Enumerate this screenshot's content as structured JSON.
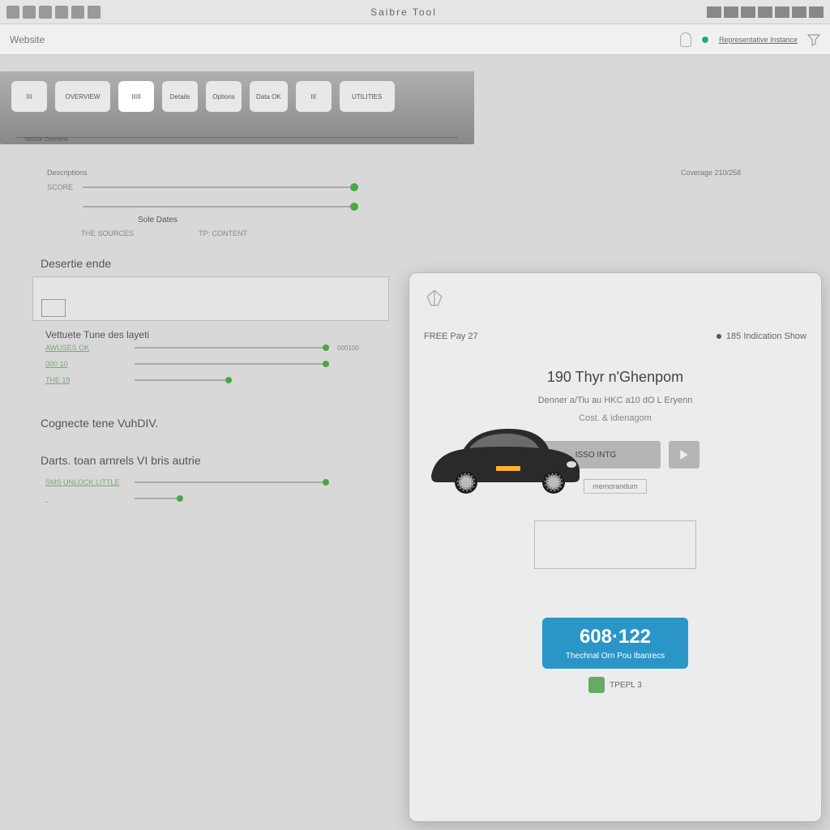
{
  "window": {
    "title": "Saibre Tool"
  },
  "toolbar": {
    "label": "Website",
    "status_text": "Representative Instance"
  },
  "tabs": {
    "items": [
      {
        "label": "III"
      },
      {
        "label": "OVERVIEW"
      },
      {
        "label": "IIIII"
      },
      {
        "label": "Details"
      },
      {
        "label": "Options"
      },
      {
        "label": "Data\nOK"
      },
      {
        "label": "III"
      },
      {
        "label": "UTILITIES"
      }
    ],
    "footer": "Vehicle Overview"
  },
  "sliders": {
    "header_left": "Descriptions",
    "header_right": "Coverage 210/258",
    "rows": [
      {
        "left": "SCORE",
        "right": ""
      },
      {
        "left": "",
        "right": ""
      }
    ],
    "label_under": "Sole Dates",
    "sub_left": "THE SOURCES",
    "sub_right": "TP: CONTENT"
  },
  "sections": {
    "desertie": "Desertie ende",
    "box_label": "",
    "vehicle_tune": "Vettuete Tune des layeti",
    "mini": [
      {
        "lbl": "AWUSES OK",
        "val": "000100"
      },
      {
        "lbl": "000 10",
        "val": ""
      },
      {
        "lbl": "THE 19",
        "val": ""
      }
    ],
    "cogre": "Cognecte tene VuhDIV.",
    "darts": "Darts. toan arnrels VI bris autrie",
    "bottom_mini": {
      "lbl": "SMS UNLOCK LITTLE",
      "val": ""
    }
  },
  "panel": {
    "header_free": "FREE Pay 27",
    "header_status": "185 Indication Show",
    "title": "190 Thyr n'Ghenpom",
    "sub1": "Denner a/Tiu au HKC a10 dO L Eryenn",
    "sub2": "Cost. & idienagom",
    "main_btn": "ISSO INTG",
    "link_text": "memorandum",
    "price": "608·122",
    "price_caption": "Thechnal Orn Pou Ibanrecs",
    "cert_text": "TPEPL 3"
  }
}
